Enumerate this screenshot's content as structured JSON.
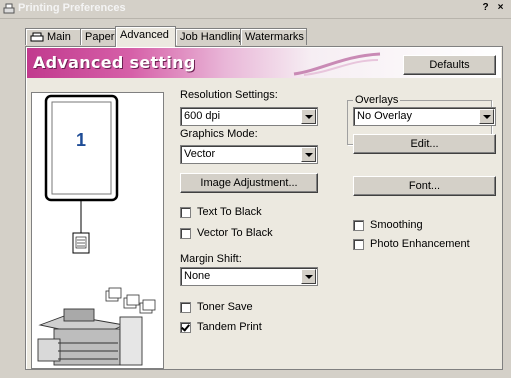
{
  "window": {
    "title": "Printing Preferences",
    "help_glyph": "?",
    "close_glyph": "×"
  },
  "tabs": [
    {
      "label": "Main"
    },
    {
      "label": "Paper"
    },
    {
      "label": "Advanced"
    },
    {
      "label": "Job Handling"
    },
    {
      "label": "Watermarks"
    }
  ],
  "active_tab": "Advanced",
  "banner": {
    "title": "Advanced setting",
    "defaults_label": "Defaults"
  },
  "preview": {
    "page_number": "1"
  },
  "resolution": {
    "label": "Resolution Settings:",
    "value": "600 dpi"
  },
  "graphics_mode": {
    "label": "Graphics Mode:",
    "value": "Vector"
  },
  "image_adjustment_label": "Image Adjustment...",
  "checkboxes": {
    "text_to_black": {
      "label": "Text To Black",
      "checked": false
    },
    "vector_to_black": {
      "label": "Vector To Black",
      "checked": false
    },
    "toner_save": {
      "label": "Toner Save",
      "checked": false
    },
    "tandem_print": {
      "label": "Tandem Print",
      "checked": true
    },
    "smoothing": {
      "label": "Smoothing",
      "checked": false
    },
    "photo_enhancement": {
      "label": "Photo Enhancement",
      "checked": false
    }
  },
  "margin_shift": {
    "label": "Margin Shift:",
    "value": "None"
  },
  "overlays": {
    "legend": "Overlays",
    "value": "No Overlay",
    "edit_label": "Edit..."
  },
  "font_label": "Font...",
  "colors": {
    "banner_magenta": "#c13a8e",
    "panel_bg": "#ece9e0",
    "window_bg": "#d4d0c8"
  }
}
